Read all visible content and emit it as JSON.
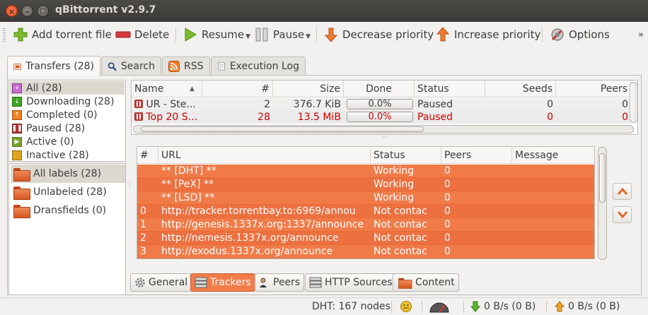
{
  "window": {
    "title": "qBittorrent v2.9.7"
  },
  "toolbar": {
    "add_torrent": "Add torrent file",
    "delete": "Delete",
    "resume": "Resume",
    "pause": "Pause",
    "decrease_priority": "Decrease priority",
    "increase_priority": "Increase priority",
    "options": "Options"
  },
  "tabs": [
    {
      "label": "Transfers (28)"
    },
    {
      "label": "Search"
    },
    {
      "label": "RSS"
    },
    {
      "label": "Execution Log"
    }
  ],
  "status_filters": [
    {
      "label": "All (28)",
      "color": "#c86ad0"
    },
    {
      "label": "Downloading (28)",
      "color": "#3ea51f"
    },
    {
      "label": "Completed (0)",
      "color": "#f0821f"
    },
    {
      "label": "Paused (28)",
      "color": "#b33333"
    },
    {
      "label": "Active (0)",
      "color": "#79a52b"
    },
    {
      "label": "Inactive (28)",
      "color": "#e0a51f"
    }
  ],
  "labels": [
    {
      "label": "All labels (28)"
    },
    {
      "label": "Unlabeled (28)"
    },
    {
      "label": "Dransfields (0)"
    }
  ],
  "transfers": {
    "columns": {
      "name": "Name",
      "num": "#",
      "size": "Size",
      "done": "Done",
      "status": "Status",
      "seeds": "Seeds",
      "peers": "Peers"
    },
    "rows": [
      {
        "name": "UR - Ste...",
        "num": "2",
        "size": "376.7 KiB",
        "done": "0.0%",
        "status": "Paused",
        "seeds": "0",
        "peers": "0",
        "color": "#000000"
      },
      {
        "name": "Top 20 S...",
        "num": "28",
        "size": "13.5 MiB",
        "done": "0.0%",
        "status": "Paused",
        "seeds": "0",
        "peers": "0",
        "color": "#cc0000"
      }
    ]
  },
  "trackers": {
    "columns": {
      "num": "#",
      "url": "URL",
      "status": "Status",
      "peers": "Peers",
      "message": "Message"
    },
    "rows": [
      {
        "num": "",
        "url": "** [DHT] **",
        "status": "Working",
        "peers": "0"
      },
      {
        "num": "",
        "url": "** [PeX] **",
        "status": "Working",
        "peers": "0"
      },
      {
        "num": "",
        "url": "** [LSD] **",
        "status": "Working",
        "peers": "0"
      },
      {
        "num": "0",
        "url": "http://tracker.torrentbay.to:6969/annou",
        "status": "Not contac",
        "peers": "0"
      },
      {
        "num": "1",
        "url": "http://genesis.1337x.org:1337/announce",
        "status": "Not contac",
        "peers": "0"
      },
      {
        "num": "2",
        "url": "http://nemesis.1337x.org/announce",
        "status": "Not contac",
        "peers": "0"
      },
      {
        "num": "3",
        "url": "http://exodus.1337x.org/announce",
        "status": "Not contac",
        "peers": "0"
      }
    ]
  },
  "bottom_tabs": {
    "general": "General",
    "trackers": "Trackers",
    "peers": "Peers",
    "http_sources": "HTTP Sources",
    "content": "Content"
  },
  "statusbar": {
    "dht": "DHT: 167 nodes",
    "download": "0 B/s (0 B)",
    "upload": "0 B/s (0 B)"
  }
}
